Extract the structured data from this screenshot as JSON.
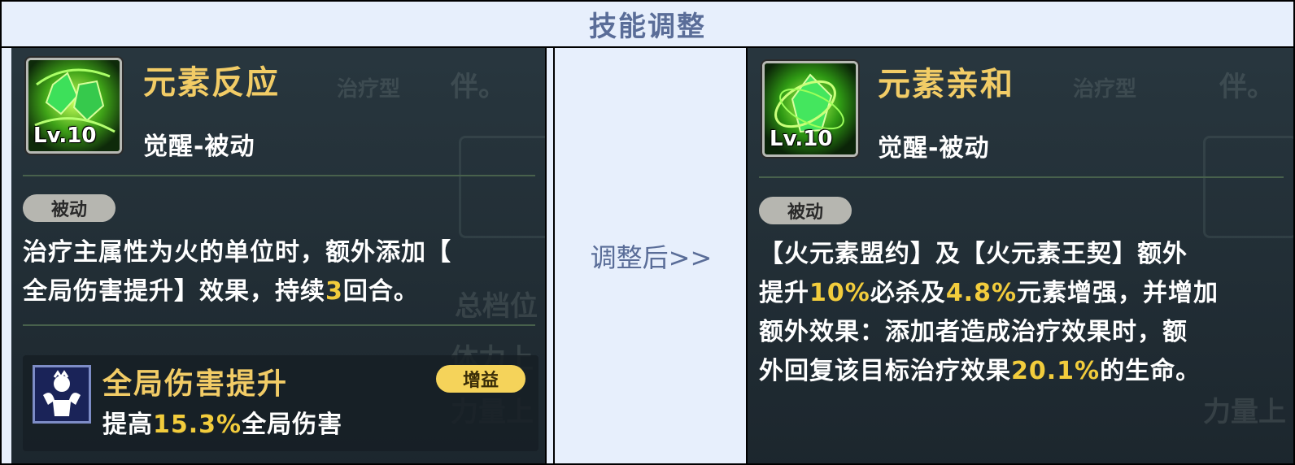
{
  "header": {
    "title": "技能调整"
  },
  "left": {
    "skill_name": "元素反应",
    "skill_level": "Lv.10",
    "skill_type": "觉醒-被动",
    "tag": "被动",
    "desc_line1": "治疗主属性为火的单位时，额外添加【",
    "desc_line2_a": "全局伤害提升】效果，持续",
    "desc_line2_hl": "3",
    "desc_line2_b": "回合。",
    "buff": {
      "name": "全局伤害提升",
      "badge": "增益",
      "desc_a": "提高",
      "desc_hl": "15.3%",
      "desc_b": "全局伤害"
    }
  },
  "middle": {
    "label": "调整后>>"
  },
  "right": {
    "skill_name": "元素亲和",
    "skill_level": "Lv.10",
    "skill_type": "觉醒-被动",
    "tag": "被动",
    "line1": "【火元素盟约】及【火元素王契】额外",
    "line2_a": "提升",
    "line2_hl1": "10%",
    "line2_b": "必杀及",
    "line2_hl2": "4.8%",
    "line2_c": "元素增强，并增加",
    "line3": "额外效果：添加者造成治疗效果时，额",
    "line4_a": "外回复该目标治疗效果",
    "line4_hl": "20.1%",
    "line4_b": "的生命。"
  },
  "colors": {
    "accent_gold": "#f2cc66",
    "highlight": "#f2cc3c",
    "title_blue": "#5a6d98",
    "panel_bg": "#1f2b33"
  },
  "icons": {
    "skill_left": "green-crystal-icon",
    "skill_right": "green-crystal-swirl-icon",
    "buff": "muscle-figure-icon"
  }
}
